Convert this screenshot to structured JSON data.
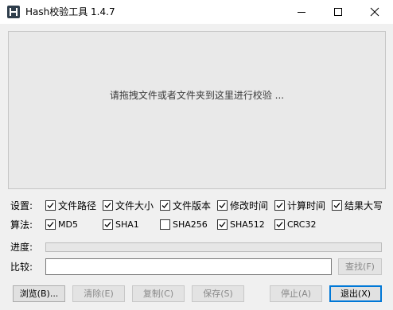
{
  "titlebar": {
    "title": "Hash校验工具 1.4.7",
    "icon": "app-logo-icon"
  },
  "dropzone": {
    "hint": "请拖拽文件或者文件夹到这里进行校验 ..."
  },
  "settings": {
    "label": "设置:",
    "options": [
      {
        "label": "文件路径",
        "checked": true
      },
      {
        "label": "文件大小",
        "checked": true
      },
      {
        "label": "文件版本",
        "checked": true
      },
      {
        "label": "修改时间",
        "checked": true
      },
      {
        "label": "计算时间",
        "checked": true
      },
      {
        "label": "结果大写",
        "checked": true
      }
    ]
  },
  "algorithms": {
    "label": "算法:",
    "options": [
      {
        "label": "MD5",
        "checked": true
      },
      {
        "label": "SHA1",
        "checked": true
      },
      {
        "label": "SHA256",
        "checked": false
      },
      {
        "label": "SHA512",
        "checked": true
      },
      {
        "label": "CRC32",
        "checked": true
      }
    ]
  },
  "progress": {
    "label": "进度:",
    "value": 0
  },
  "compare": {
    "label": "比较:",
    "value": "",
    "find_button": "查找(F)"
  },
  "buttons": {
    "browse": "浏览(B)...",
    "clear": "清除(E)",
    "copy": "复制(C)",
    "save": "保存(S)",
    "stop": "停止(A)",
    "exit": "退出(X)"
  }
}
